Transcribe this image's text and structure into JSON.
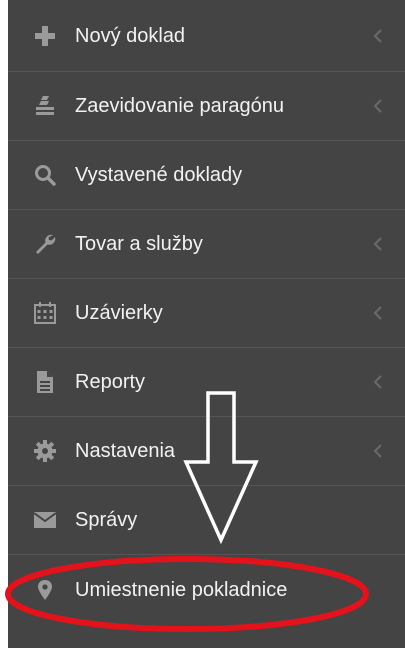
{
  "menu": {
    "items": [
      {
        "label": "Nový doklad",
        "icon": "plus-icon",
        "has_submenu": true
      },
      {
        "label": "Zaevidovanie paragónu",
        "icon": "receipt-stack-icon",
        "has_submenu": true
      },
      {
        "label": "Vystavené doklady",
        "icon": "search-icon",
        "has_submenu": false
      },
      {
        "label": "Tovar a služby",
        "icon": "wrench-icon",
        "has_submenu": true
      },
      {
        "label": "Uzávierky",
        "icon": "calendar-icon",
        "has_submenu": true
      },
      {
        "label": "Reporty",
        "icon": "document-icon",
        "has_submenu": true
      },
      {
        "label": "Nastavenia",
        "icon": "gear-icon",
        "has_submenu": true
      },
      {
        "label": "Správy",
        "icon": "envelope-icon",
        "has_submenu": false
      },
      {
        "label": "Umiestnenie pokladnice",
        "icon": "map-marker-icon",
        "has_submenu": false
      }
    ]
  },
  "colors": {
    "sidebar_bg": "#444444",
    "divider": "#555555",
    "text": "#f2f2f2",
    "icon": "#9a9a9a",
    "chevron": "#6a6a6a",
    "annotation_red": "#e3121b",
    "annotation_arrow": "#ffffff"
  }
}
